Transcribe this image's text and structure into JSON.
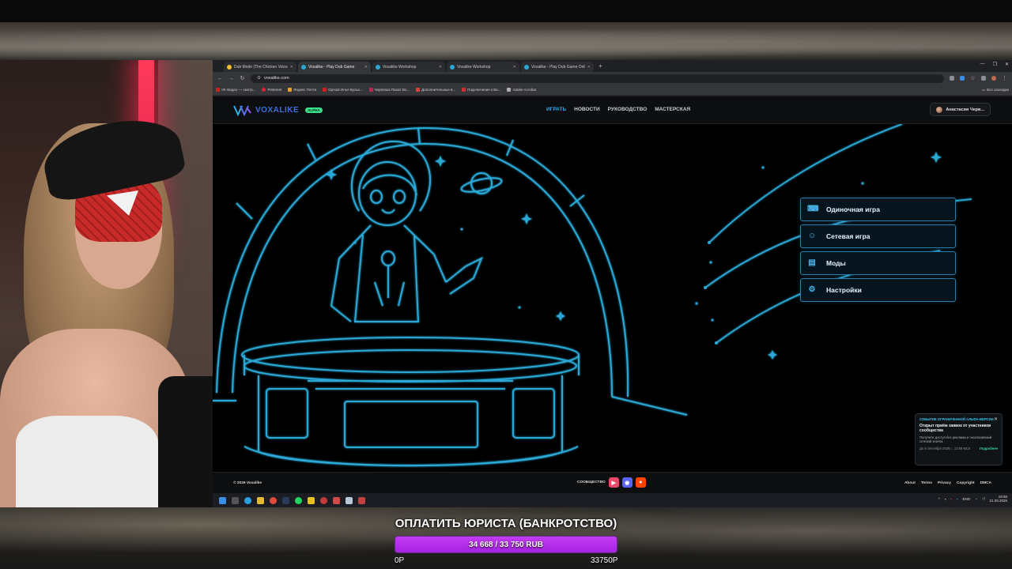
{
  "browser": {
    "tabs": [
      {
        "title": "Dub Mode (The Chicken Voice)",
        "active": false
      },
      {
        "title": "Voxalike - Play Dub Game",
        "active": true
      },
      {
        "title": "Voxalike Workshop",
        "active": false
      },
      {
        "title": "Voxalike Workshop",
        "active": false
      },
      {
        "title": "Voxalike - Play Dub Game Onli",
        "active": false
      }
    ],
    "url": "voxalike.com",
    "bookmarks": [
      "VK Видео — смотр...",
      "Pinterest",
      "Яндекс Почта",
      "Оргков Илья Бульк...",
      "Черепаха Пиоат Во...",
      "Дополнительные в...",
      "Подключение к Ви...",
      "Adobe Acrobat"
    ],
    "bookmarks_all": "Все закладки"
  },
  "site": {
    "logo_text": "VOXALIKE",
    "alpha_badge": "ALPHA",
    "nav": [
      {
        "label": "ИГРАТЬ",
        "active": true
      },
      {
        "label": "НОВОСТИ",
        "active": false
      },
      {
        "label": "РУКОВОДСТВО",
        "active": false
      },
      {
        "label": "МАСТЕРСКАЯ",
        "active": false
      }
    ],
    "user_name": "Анастасия Черв...",
    "menu": [
      {
        "label": "Одиночная игра",
        "icon": "gamepad-icon"
      },
      {
        "label": "Сетевая игра",
        "icon": "users-icon"
      },
      {
        "label": "Моды",
        "icon": "mods-icon"
      },
      {
        "label": "Настройки",
        "icon": "gear-icon"
      }
    ],
    "toast": {
      "event": "СОБЫТИЕ ОГРАНИЧЕННОЙ АЛЬФА-ВЕРСИИ",
      "title": "Открыт приём заявок от участников сообщества",
      "body": "Получите доступ без рекламы и эксклюзивный сетевой значок.",
      "deadline": "До 8 сентября 2026 г., 13:59 МСК",
      "more": "Подробнее"
    },
    "footer": {
      "copyright": "© 2026 Voxalike",
      "community": "СООБЩЕСТВО",
      "links": [
        "About",
        "Terms",
        "Privacy",
        "Copyright",
        "DMCA"
      ]
    }
  },
  "taskbar": {
    "lang": "ENG",
    "time": "19:55",
    "date": "21.09.2026"
  },
  "donation": {
    "title": "ОПЛАТИТЬ ЮРИСТА (БАНКРОТСТВО)",
    "progress_text": "34 668 / 33 750 RUB",
    "progress_fraction": 1.0,
    "min_label": "0Р",
    "max_label": "33750Р"
  },
  "colors": {
    "accent": "#37a6e6",
    "neon_line": "#2aa8d6",
    "donation_fill": "#b030e8"
  }
}
